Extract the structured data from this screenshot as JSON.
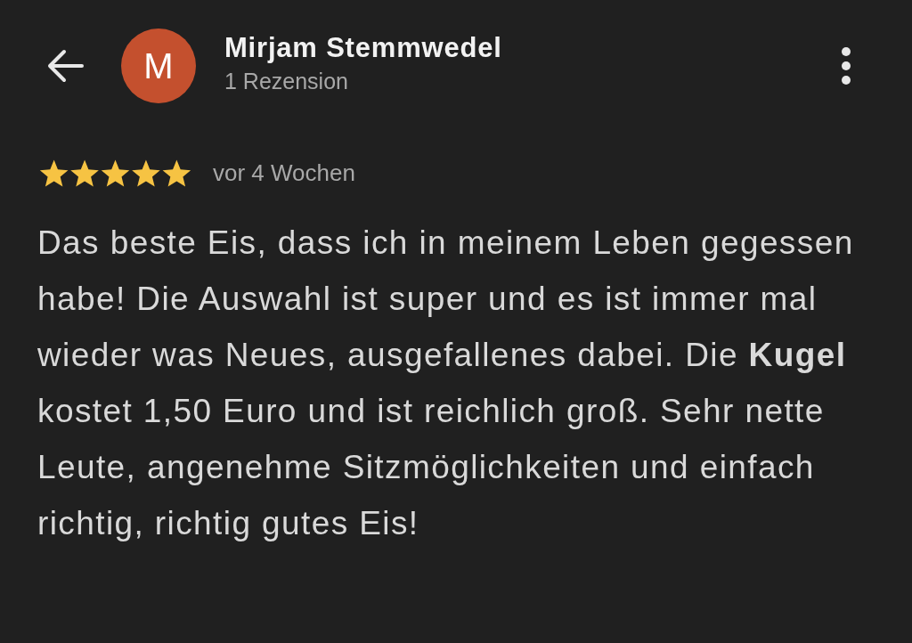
{
  "header": {
    "reviewer_name": "Mirjam Stemmwedel",
    "avatar_letter": "M",
    "review_count": "1 Rezension"
  },
  "review": {
    "stars": 5,
    "time": "vor 4 Wochen",
    "text": "Das beste Eis, dass ich in meinem Leben gegessen habe! Die Auswahl ist super und es ist immer mal wieder was Neues, ausgefallenes dabei. Die **Kugel** kostet 1,50 Euro und ist reichlich groß. Sehr nette Leute, angenehme Sitzmöglichkeiten und einfach richtig, richtig gutes Eis!"
  }
}
